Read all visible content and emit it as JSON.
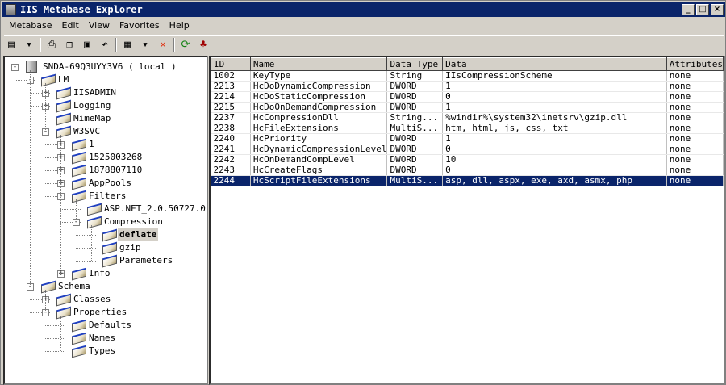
{
  "window": {
    "title": "IIS Metabase Explorer",
    "minimize": "_",
    "maximize": "□",
    "close": "×"
  },
  "menu": [
    "Metabase",
    "Edit",
    "View",
    "Favorites",
    "Help"
  ],
  "toolbar": [
    {
      "icon": "computer-icon",
      "glyph": "▤"
    },
    {
      "icon": "dropdown-arrow-icon",
      "glyph": "▾"
    },
    {
      "sep": true
    },
    {
      "icon": "print-icon",
      "glyph": "⎙"
    },
    {
      "icon": "copy-icon",
      "glyph": "❐"
    },
    {
      "icon": "paste-icon",
      "glyph": "▣"
    },
    {
      "icon": "undo-icon",
      "glyph": "↶"
    },
    {
      "sep": true
    },
    {
      "icon": "new-key-icon",
      "glyph": "▦"
    },
    {
      "icon": "dropdown-arrow-icon",
      "glyph": "▾"
    },
    {
      "icon": "delete-icon",
      "glyph": "✕",
      "color": "#e03010"
    },
    {
      "sep": true
    },
    {
      "icon": "refresh-icon",
      "glyph": "⟳",
      "color": "#108010"
    },
    {
      "icon": "hierarchy-icon",
      "glyph": "♣",
      "color": "#a00000"
    }
  ],
  "tree": [
    {
      "label": "SNDA-69Q3UYY3V6 ( local )",
      "level": 0,
      "exp": "-",
      "type": "server"
    },
    {
      "label": "LM",
      "level": 1,
      "exp": "-"
    },
    {
      "label": "IISADMIN",
      "level": 2,
      "exp": "+"
    },
    {
      "label": "Logging",
      "level": 2,
      "exp": "+"
    },
    {
      "label": "MimeMap",
      "level": 2,
      "exp": ""
    },
    {
      "label": "W3SVC",
      "level": 2,
      "exp": "-"
    },
    {
      "label": "1",
      "level": 3,
      "exp": "+"
    },
    {
      "label": "1525003268",
      "level": 3,
      "exp": "+"
    },
    {
      "label": "1878807110",
      "level": 3,
      "exp": "+"
    },
    {
      "label": "AppPools",
      "level": 3,
      "exp": "+"
    },
    {
      "label": "Filters",
      "level": 3,
      "exp": "-"
    },
    {
      "label": "ASP.NET_2.0.50727.0",
      "level": 4,
      "exp": ""
    },
    {
      "label": "Compression",
      "level": 4,
      "exp": "-"
    },
    {
      "label": "deflate",
      "level": 5,
      "exp": "",
      "selected": true
    },
    {
      "label": "gzip",
      "level": 5,
      "exp": ""
    },
    {
      "label": "Parameters",
      "level": 5,
      "exp": ""
    },
    {
      "label": "Info",
      "level": 3,
      "exp": "+"
    },
    {
      "label": "Schema",
      "level": 1,
      "exp": "-"
    },
    {
      "label": "Classes",
      "level": 2,
      "exp": "+"
    },
    {
      "label": "Properties",
      "level": 2,
      "exp": "-"
    },
    {
      "label": "Defaults",
      "level": 3,
      "exp": ""
    },
    {
      "label": "Names",
      "level": 3,
      "exp": ""
    },
    {
      "label": "Types",
      "level": 3,
      "exp": ""
    }
  ],
  "table": {
    "columns": [
      "ID",
      "Name",
      "Data Type",
      "Data",
      "Attributes"
    ],
    "rows": [
      [
        "1002",
        "KeyType",
        "String",
        "IIsCompressionScheme",
        "none"
      ],
      [
        "2213",
        "HcDoDynamicCompression",
        "DWORD",
        "1",
        "none"
      ],
      [
        "2214",
        "HcDoStaticCompression",
        "DWORD",
        "0",
        "none"
      ],
      [
        "2215",
        "HcDoOnDemandCompression",
        "DWORD",
        "1",
        "none"
      ],
      [
        "2237",
        "HcCompressionDll",
        "String...",
        "%windir%\\system32\\inetsrv\\gzip.dll",
        "none"
      ],
      [
        "2238",
        "HcFileExtensions",
        "MultiS...",
        "htm, html, js, css, txt",
        "none"
      ],
      [
        "2240",
        "HcPriority",
        "DWORD",
        "1",
        "none"
      ],
      [
        "2241",
        "HcDynamicCompressionLevel",
        "DWORD",
        "0",
        "none"
      ],
      [
        "2242",
        "HcOnDemandCompLevel",
        "DWORD",
        "10",
        "none"
      ],
      [
        "2243",
        "HcCreateFlags",
        "DWORD",
        "0",
        "none"
      ],
      [
        "2244",
        "HcScriptFileExtensions",
        "MultiS...",
        "asp, dll, aspx, exe, axd, asmx, php",
        "none"
      ]
    ],
    "selected_row": 10
  },
  "colors": {
    "titlebar": "#0a246a",
    "selection": "#0a246a"
  }
}
